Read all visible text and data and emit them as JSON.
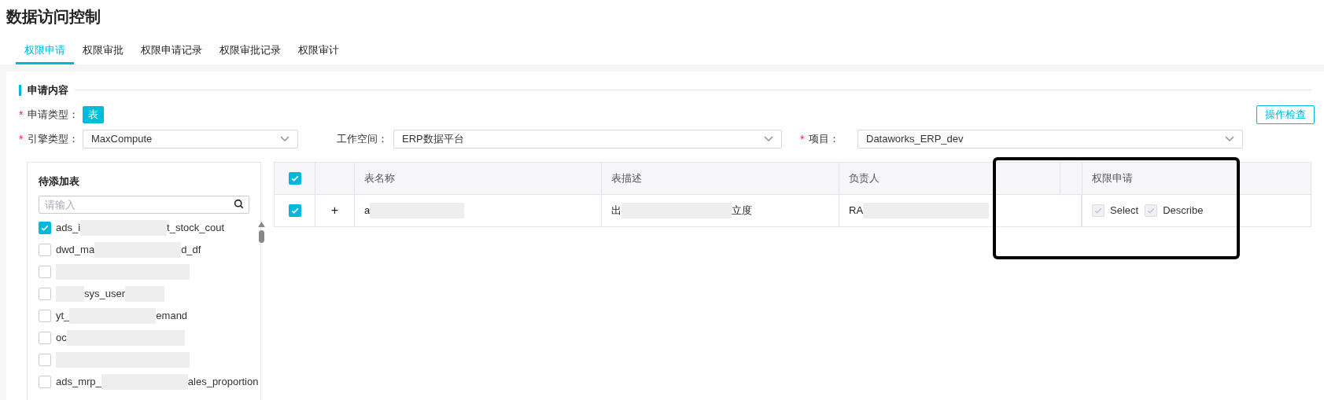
{
  "page_title": "数据访问控制",
  "tabs": [
    {
      "label": "权限申请",
      "selected": true
    },
    {
      "label": "权限审批",
      "selected": false
    },
    {
      "label": "权限申请记录",
      "selected": false
    },
    {
      "label": "权限审批记录",
      "selected": false
    },
    {
      "label": "权限审计",
      "selected": false
    }
  ],
  "section_title": "申请内容",
  "check_button": "操作检查",
  "request_type": {
    "marker": "*",
    "label": "申请类型：",
    "options": [
      {
        "label": "表",
        "selected": true
      }
    ]
  },
  "selects": [
    {
      "marker": "*",
      "label": "引擎类型：",
      "value": "MaxCompute"
    },
    {
      "label": "工作空间：",
      "value": "ERP数据平台"
    },
    {
      "marker": "*",
      "label": "项目：",
      "value": "Dataworks_ERP_dev"
    }
  ],
  "pending_tables": {
    "title": "待添加表",
    "placeholder": "请输入",
    "items": [
      {
        "parts": [
          "ads_i",
          "t_stock_cout"
        ],
        "kind": "middle",
        "checked": true
      },
      {
        "parts": [
          "dwd_ma",
          "d_df"
        ],
        "kind": "middle",
        "checked": false
      },
      {
        "kind": "full",
        "checked": false
      },
      {
        "parts": [
          "sys_user"
        ],
        "kind": "around",
        "checked": false
      },
      {
        "parts": [
          "yt_",
          "emand"
        ],
        "kind": "middle",
        "checked": false
      },
      {
        "parts": [
          "oc"
        ],
        "kind": "after",
        "checked": false
      },
      {
        "kind": "full",
        "checked": false
      },
      {
        "parts": [
          "ads_mrp_",
          "ales_proportion"
        ],
        "kind": "middle",
        "checked": false
      }
    ]
  },
  "table": {
    "all_checked": true,
    "columns": [
      "表名称",
      "表描述",
      "负责人",
      "权限申请"
    ],
    "rows": [
      {
        "checked": true,
        "expand": "+",
        "name": "a",
        "description": [
          "出",
          "立度"
        ],
        "owner": "RA",
        "permissions": [
          {
            "label": "Select",
            "checked": true,
            "disabled": true
          },
          {
            "label": "Describe",
            "checked": true,
            "disabled": true
          }
        ]
      }
    ]
  },
  "highlight_frame": true
}
